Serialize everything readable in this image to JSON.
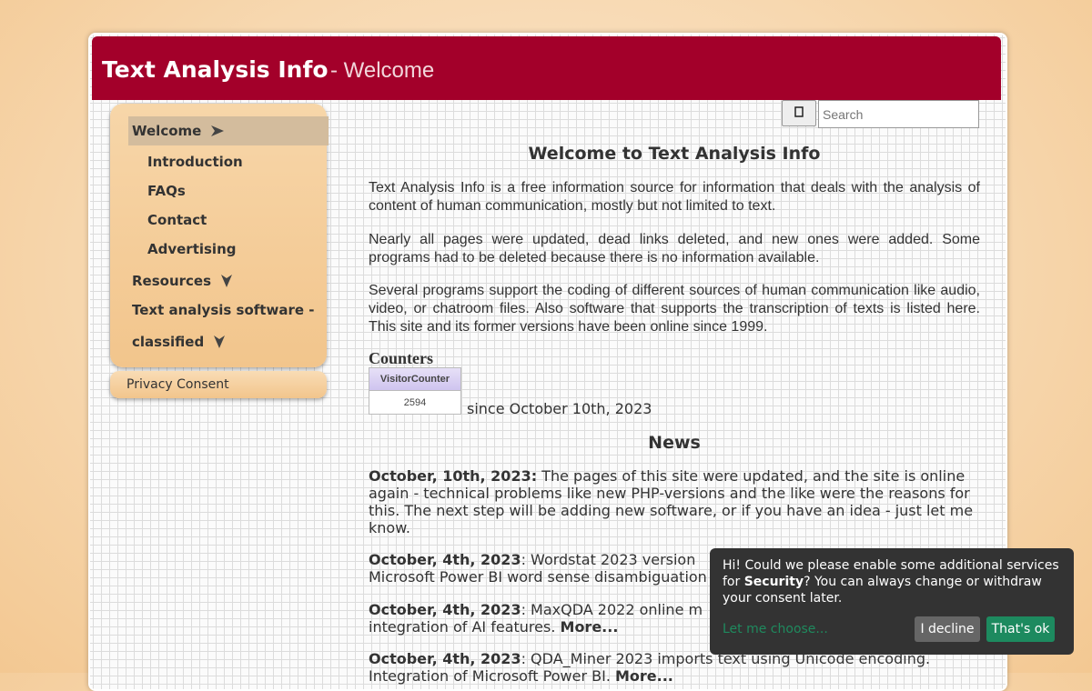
{
  "header": {
    "title": "Text Analysis Info",
    "subtitle": "- Welcome"
  },
  "menu": {
    "welcome": "Welcome",
    "introduction": "Introduction",
    "faqs": "FAQs",
    "contact": "Contact",
    "advertising": "Advertising",
    "resources": "Resources",
    "software_line1": "Text analysis software -",
    "software_line2": "classified",
    "privacy": "Privacy Consent"
  },
  "search": {
    "placeholder": "Search",
    "button_icon": "search-icon"
  },
  "main": {
    "heading": "Welcome to Text Analysis Info",
    "para1": "Text Analysis Info is a free information source for information that deals with the analysis of content of human communication, mostly but not limited to text.",
    "para2": "Nearly all pages were updated, dead links deleted, and new ones were added. Some programs had to be deleted because there is no information available.",
    "para3": "Several programs support the coding of different sources of human communication like audio, video, or chatroom files. Also software that supports the transcription of texts is listed here. This site and its former versions have been online since 1999.",
    "counters_heading": "Counters",
    "counter_label": "VisitorCounter",
    "counter_value": "2594",
    "since": "since October 10th, 2023",
    "news_heading": "News"
  },
  "news": [
    {
      "date": "October, 10th, 2023:",
      "text": " The pages of this site were updated, and the site is online again - technical problems like new PHP-versions and the like were the reasons for this. The next step will be adding new software, or if you have an idea - just let me know."
    },
    {
      "date": "October, 4th, 2023",
      "text": ": Wordstat 2023 version",
      "line2": "Microsoft Power BI word sense disambiguation"
    },
    {
      "date": "October, 4th, 2023",
      "text": ": MaxQDA 2022 online m",
      "line2": "integration of AI features. ",
      "more": "More..."
    },
    {
      "date": "October, 4th, 2023",
      "text": ": QDA_Miner 2023 imports text using Unicode encoding.",
      "line2": "Integration of Microsoft Power BI. ",
      "more": "More..."
    }
  ],
  "cookie": {
    "msg_before": "Hi! Could we please enable some additional services for ",
    "msg_bold": "Security",
    "msg_after": "? You can always change or withdraw your consent later.",
    "choose": "Let me choose...",
    "decline": "I decline",
    "ok": "That's ok"
  },
  "colors": {
    "header": "#a3002a",
    "menu": "#f2c58c",
    "accept": "#1d8a5f"
  }
}
